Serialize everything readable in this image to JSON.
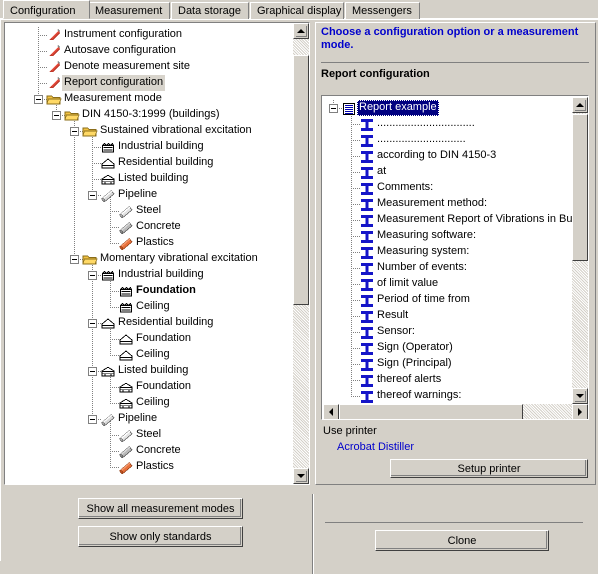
{
  "window": {
    "tabs": [
      {
        "label": "Configuration",
        "selected": true
      },
      {
        "label": "Measurement",
        "selected": false
      },
      {
        "label": "Data storage",
        "selected": false
      },
      {
        "label": "Graphical display",
        "selected": false
      },
      {
        "label": "Messengers",
        "selected": false
      }
    ]
  },
  "left_panel": {
    "tree": [
      {
        "label": "Instrument configuration",
        "depth": 1,
        "icon": "pencil-icon",
        "expander": "none",
        "state": "normal"
      },
      {
        "label": "Autosave configuration",
        "depth": 1,
        "icon": "pencil-icon",
        "expander": "none",
        "state": "normal"
      },
      {
        "label": "Denote measurement site",
        "depth": 1,
        "icon": "pencil-icon",
        "expander": "none",
        "state": "normal"
      },
      {
        "label": "Report configuration",
        "depth": 1,
        "icon": "pencil-icon",
        "expander": "none",
        "state": "selected"
      },
      {
        "label": "Measurement mode",
        "depth": 1,
        "icon": "folder-icon",
        "expander": "minus",
        "state": "normal"
      },
      {
        "label": "DIN 4150-3:1999 (buildings)",
        "depth": 2,
        "icon": "folder-icon",
        "expander": "minus",
        "state": "normal"
      },
      {
        "label": "Sustained vibrational excitation",
        "depth": 3,
        "icon": "folder-icon",
        "expander": "minus",
        "state": "normal"
      },
      {
        "label": "Industrial building",
        "depth": 4,
        "icon": "industrial-building-icon",
        "expander": "none",
        "state": "normal"
      },
      {
        "label": "Residential building",
        "depth": 4,
        "icon": "residential-building-icon",
        "expander": "none",
        "state": "normal"
      },
      {
        "label": "Listed building",
        "depth": 4,
        "icon": "listed-building-icon",
        "expander": "none",
        "state": "normal"
      },
      {
        "label": "Pipeline",
        "depth": 4,
        "icon": "pipe-grey-icon",
        "expander": "minus",
        "state": "normal"
      },
      {
        "label": "Steel",
        "depth": 5,
        "icon": "pipe-steel-icon",
        "expander": "none",
        "state": "normal"
      },
      {
        "label": "Concrete",
        "depth": 5,
        "icon": "pipe-concrete-icon",
        "expander": "none",
        "state": "normal"
      },
      {
        "label": "Plastics",
        "depth": 5,
        "icon": "pipe-plastics-icon",
        "expander": "none",
        "state": "normal"
      },
      {
        "label": "Momentary vibrational excitation",
        "depth": 3,
        "icon": "folder-icon",
        "expander": "minus",
        "state": "normal"
      },
      {
        "label": "Industrial building",
        "depth": 4,
        "icon": "industrial-building-icon",
        "expander": "minus",
        "state": "normal"
      },
      {
        "label": "Foundation",
        "depth": 5,
        "icon": "industrial-building-icon",
        "expander": "none",
        "state": "bold"
      },
      {
        "label": "Ceiling",
        "depth": 5,
        "icon": "industrial-building-icon",
        "expander": "none",
        "state": "normal"
      },
      {
        "label": "Residential building",
        "depth": 4,
        "icon": "residential-building-icon",
        "expander": "minus",
        "state": "normal"
      },
      {
        "label": "Foundation",
        "depth": 5,
        "icon": "residential-building-icon",
        "expander": "none",
        "state": "normal"
      },
      {
        "label": "Ceiling",
        "depth": 5,
        "icon": "residential-building-icon",
        "expander": "none",
        "state": "normal"
      },
      {
        "label": "Listed building",
        "depth": 4,
        "icon": "listed-building-icon",
        "expander": "minus",
        "state": "normal"
      },
      {
        "label": "Foundation",
        "depth": 5,
        "icon": "listed-building-icon",
        "expander": "none",
        "state": "normal"
      },
      {
        "label": "Ceiling",
        "depth": 5,
        "icon": "listed-building-icon",
        "expander": "none",
        "state": "normal"
      },
      {
        "label": "Pipeline",
        "depth": 4,
        "icon": "pipe-grey-icon",
        "expander": "minus",
        "state": "normal"
      },
      {
        "label": "Steel",
        "depth": 5,
        "icon": "pipe-steel-icon",
        "expander": "none",
        "state": "normal"
      },
      {
        "label": "Concrete",
        "depth": 5,
        "icon": "pipe-concrete-icon",
        "expander": "none",
        "state": "normal"
      },
      {
        "label": "Plastics",
        "depth": 5,
        "icon": "pipe-plastics-icon",
        "expander": "none",
        "state": "normal"
      }
    ],
    "buttons": {
      "show_all": "Show all measurement modes",
      "show_standards": "Show only standards"
    }
  },
  "right_panel": {
    "hint": "Choose a configuration option or a measurement mode.",
    "section_title": "Report configuration",
    "report_tree": [
      {
        "label": "Report example",
        "depth": 0,
        "icon": "report-document-icon",
        "expander": "minus",
        "state": "selected"
      },
      {
        "label": "................................",
        "depth": 1,
        "icon": "text-field-icon",
        "expander": "none",
        "state": "normal"
      },
      {
        "label": ".............................",
        "depth": 1,
        "icon": "text-field-icon",
        "expander": "none",
        "state": "normal"
      },
      {
        "label": "according to DIN 4150-3",
        "depth": 1,
        "icon": "text-field-icon",
        "expander": "none",
        "state": "normal"
      },
      {
        "label": "at",
        "depth": 1,
        "icon": "text-field-icon",
        "expander": "none",
        "state": "normal"
      },
      {
        "label": "Comments:",
        "depth": 1,
        "icon": "text-field-icon",
        "expander": "none",
        "state": "normal"
      },
      {
        "label": "Measurement method:",
        "depth": 1,
        "icon": "text-field-icon",
        "expander": "none",
        "state": "normal"
      },
      {
        "label": "Measurement Report of Vibrations in Bu",
        "depth": 1,
        "icon": "text-field-icon",
        "expander": "none",
        "state": "normal"
      },
      {
        "label": "Measuring software:",
        "depth": 1,
        "icon": "text-field-icon",
        "expander": "none",
        "state": "normal"
      },
      {
        "label": "Measuring system:",
        "depth": 1,
        "icon": "text-field-icon",
        "expander": "none",
        "state": "normal"
      },
      {
        "label": "Number of events:",
        "depth": 1,
        "icon": "text-field-icon",
        "expander": "none",
        "state": "normal"
      },
      {
        "label": "of limit value",
        "depth": 1,
        "icon": "text-field-icon",
        "expander": "none",
        "state": "normal"
      },
      {
        "label": "Period of time from",
        "depth": 1,
        "icon": "text-field-icon",
        "expander": "none",
        "state": "normal"
      },
      {
        "label": "Result",
        "depth": 1,
        "icon": "text-field-icon",
        "expander": "none",
        "state": "normal"
      },
      {
        "label": "Sensor:",
        "depth": 1,
        "icon": "text-field-icon",
        "expander": "none",
        "state": "normal"
      },
      {
        "label": "Sign (Operator)",
        "depth": 1,
        "icon": "text-field-icon",
        "expander": "none",
        "state": "normal"
      },
      {
        "label": "Sign (Principal)",
        "depth": 1,
        "icon": "text-field-icon",
        "expander": "none",
        "state": "normal"
      },
      {
        "label": "thereof alerts",
        "depth": 1,
        "icon": "text-field-icon",
        "expander": "none",
        "state": "normal"
      },
      {
        "label": "thereof warnings:",
        "depth": 1,
        "icon": "text-field-icon",
        "expander": "none",
        "state": "normal"
      }
    ],
    "printer_label": "Use printer",
    "printer_name": "Acrobat Distiller",
    "setup_printer_button": "Setup printer",
    "clone_button": "Clone"
  },
  "colors": {
    "face": "#d4d0c8",
    "hint_blue": "#0000cc",
    "selection_blue": "#000080",
    "folder_yellow": "#f0c040"
  }
}
